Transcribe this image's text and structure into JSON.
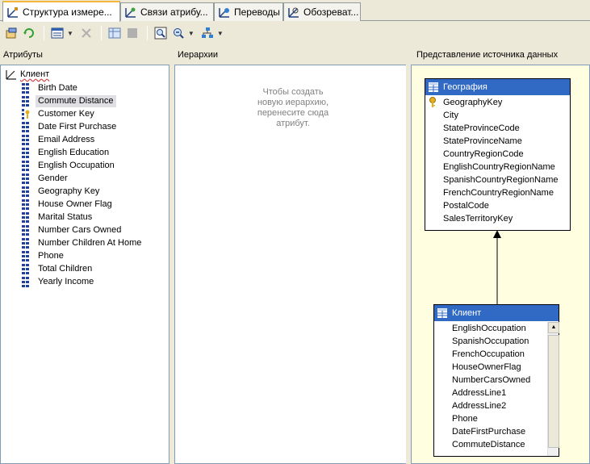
{
  "tabs": [
    {
      "label": "Структура измере...",
      "active": true
    },
    {
      "label": "Связи атрибу...",
      "active": false
    },
    {
      "label": "Переводы",
      "active": false
    },
    {
      "label": "Обозреват...",
      "active": false
    }
  ],
  "toolbar": {
    "icons": [
      "new-attribute-icon",
      "refresh-icon",
      "view-list-icon",
      "delete-icon",
      "grid-icon",
      "stop-icon",
      "zoom-fit-icon",
      "zoom-out-icon",
      "layout-icon"
    ]
  },
  "panes": {
    "attributes_title": "Атрибуты",
    "hierarchies_title": "Иерархии",
    "dsv_title": "Представление источника данных"
  },
  "attributes": {
    "root": "Клиент",
    "items": [
      {
        "label": "Birth Date",
        "icon": "attribute-icon"
      },
      {
        "label": "Commute Distance",
        "icon": "attribute-icon",
        "selected": true
      },
      {
        "label": "Customer Key",
        "icon": "key-attribute-icon"
      },
      {
        "label": "Date First Purchase",
        "icon": "attribute-icon"
      },
      {
        "label": "Email Address",
        "icon": "attribute-icon"
      },
      {
        "label": "English Education",
        "icon": "attribute-icon"
      },
      {
        "label": "English Occupation",
        "icon": "attribute-icon"
      },
      {
        "label": "Gender",
        "icon": "attribute-icon"
      },
      {
        "label": "Geography Key",
        "icon": "attribute-icon"
      },
      {
        "label": "House Owner Flag",
        "icon": "attribute-icon"
      },
      {
        "label": "Marital Status",
        "icon": "attribute-icon"
      },
      {
        "label": "Number Cars Owned",
        "icon": "attribute-icon"
      },
      {
        "label": "Number Children At Home",
        "icon": "attribute-icon"
      },
      {
        "label": "Phone",
        "icon": "attribute-icon"
      },
      {
        "label": "Total Children",
        "icon": "attribute-icon"
      },
      {
        "label": "Yearly Income",
        "icon": "attribute-icon"
      }
    ]
  },
  "hierarchies": {
    "hint_lines": [
      "Чтобы создать",
      "новую иерархию,",
      "перенесите сюда",
      "атрибут."
    ]
  },
  "dsv": {
    "geography": {
      "title": "География",
      "columns": [
        "GeographyKey",
        "City",
        "StateProvinceCode",
        "StateProvinceName",
        "CountryRegionCode",
        "EnglishCountryRegionName",
        "SpanishCountryRegionName",
        "FrenchCountryRegionName",
        "PostalCode",
        "SalesTerritoryKey"
      ],
      "key_column": "GeographyKey"
    },
    "client": {
      "title": "Клиент",
      "columns": [
        "EnglishOccupation",
        "SpanishOccupation",
        "FrenchOccupation",
        "HouseOwnerFlag",
        "NumberCarsOwned",
        "AddressLine1",
        "AddressLine2",
        "Phone",
        "DateFirstPurchase",
        "CommuteDistance"
      ]
    },
    "colors": {
      "header": "#316ac5",
      "background": "#fffee0"
    }
  }
}
